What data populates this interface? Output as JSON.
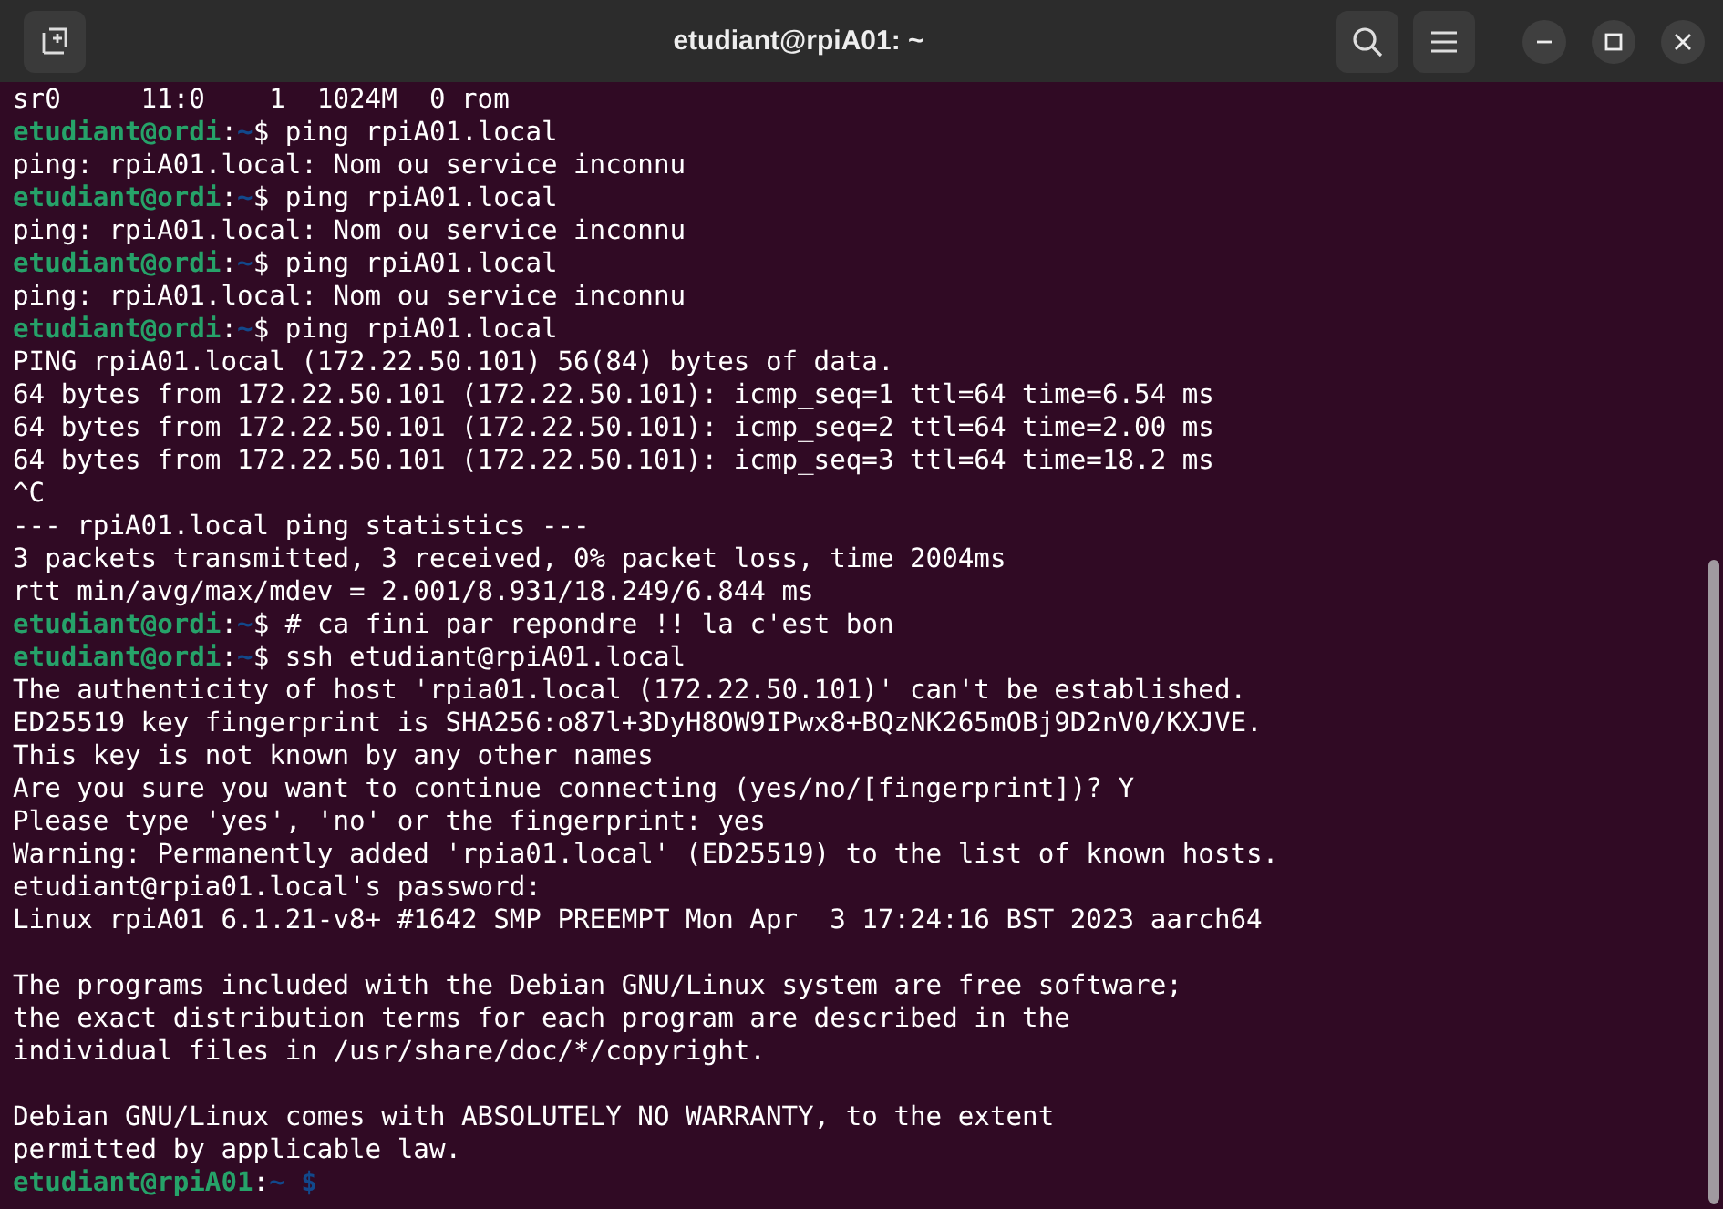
{
  "window": {
    "title": "etudiant@rpiA01: ~"
  },
  "terminal": {
    "lines": [
      {
        "kind": "output",
        "text": "sr0     11:0    1  1024M  0 rom"
      },
      {
        "kind": "prompt",
        "user_host": "etudiant@ordi",
        "separator": ":",
        "path": "~",
        "symbol": "$",
        "command": " ping rpiA01.local"
      },
      {
        "kind": "output",
        "text": "ping: rpiA01.local: Nom ou service inconnu"
      },
      {
        "kind": "prompt",
        "user_host": "etudiant@ordi",
        "separator": ":",
        "path": "~",
        "symbol": "$",
        "command": " ping rpiA01.local"
      },
      {
        "kind": "output",
        "text": "ping: rpiA01.local: Nom ou service inconnu"
      },
      {
        "kind": "prompt",
        "user_host": "etudiant@ordi",
        "separator": ":",
        "path": "~",
        "symbol": "$",
        "command": " ping rpiA01.local"
      },
      {
        "kind": "output",
        "text": "ping: rpiA01.local: Nom ou service inconnu"
      },
      {
        "kind": "prompt",
        "user_host": "etudiant@ordi",
        "separator": ":",
        "path": "~",
        "symbol": "$",
        "command": " ping rpiA01.local"
      },
      {
        "kind": "output",
        "text": "PING rpiA01.local (172.22.50.101) 56(84) bytes of data."
      },
      {
        "kind": "output",
        "text": "64 bytes from 172.22.50.101 (172.22.50.101): icmp_seq=1 ttl=64 time=6.54 ms"
      },
      {
        "kind": "output",
        "text": "64 bytes from 172.22.50.101 (172.22.50.101): icmp_seq=2 ttl=64 time=2.00 ms"
      },
      {
        "kind": "output",
        "text": "64 bytes from 172.22.50.101 (172.22.50.101): icmp_seq=3 ttl=64 time=18.2 ms"
      },
      {
        "kind": "output",
        "text": "^C"
      },
      {
        "kind": "output",
        "text": "--- rpiA01.local ping statistics ---"
      },
      {
        "kind": "output",
        "text": "3 packets transmitted, 3 received, 0% packet loss, time 2004ms"
      },
      {
        "kind": "output",
        "text": "rtt min/avg/max/mdev = 2.001/8.931/18.249/6.844 ms"
      },
      {
        "kind": "prompt",
        "user_host": "etudiant@ordi",
        "separator": ":",
        "path": "~",
        "symbol": "$",
        "command": " # ca fini par repondre !! la c'est bon"
      },
      {
        "kind": "prompt",
        "user_host": "etudiant@ordi",
        "separator": ":",
        "path": "~",
        "symbol": "$",
        "command": " ssh etudiant@rpiA01.local"
      },
      {
        "kind": "output",
        "text": "The authenticity of host 'rpia01.local (172.22.50.101)' can't be established."
      },
      {
        "kind": "output",
        "text": "ED25519 key fingerprint is SHA256:o87l+3DyH8OW9IPwx8+BQzNK265mOBj9D2nV0/KXJVE."
      },
      {
        "kind": "output",
        "text": "This key is not known by any other names"
      },
      {
        "kind": "output",
        "text": "Are you sure you want to continue connecting (yes/no/[fingerprint])? Y"
      },
      {
        "kind": "output",
        "text": "Please type 'yes', 'no' or the fingerprint: yes"
      },
      {
        "kind": "output",
        "text": "Warning: Permanently added 'rpia01.local' (ED25519) to the list of known hosts."
      },
      {
        "kind": "output",
        "text": "etudiant@rpia01.local's password:"
      },
      {
        "kind": "output",
        "text": "Linux rpiA01 6.1.21-v8+ #1642 SMP PREEMPT Mon Apr  3 17:24:16 BST 2023 aarch64"
      },
      {
        "kind": "blank"
      },
      {
        "kind": "output",
        "text": "The programs included with the Debian GNU/Linux system are free software;"
      },
      {
        "kind": "output",
        "text": "the exact distribution terms for each program are described in the"
      },
      {
        "kind": "output",
        "text": "individual files in /usr/share/doc/*/copyright."
      },
      {
        "kind": "blank"
      },
      {
        "kind": "output",
        "text": "Debian GNU/Linux comes with ABSOLUTELY NO WARRANTY, to the extent"
      },
      {
        "kind": "output",
        "text": "permitted by applicable law."
      },
      {
        "kind": "remote_prompt",
        "user_host": "etudiant@rpiA01",
        "separator": ":",
        "path": "~ ",
        "symbol": "$"
      }
    ]
  }
}
